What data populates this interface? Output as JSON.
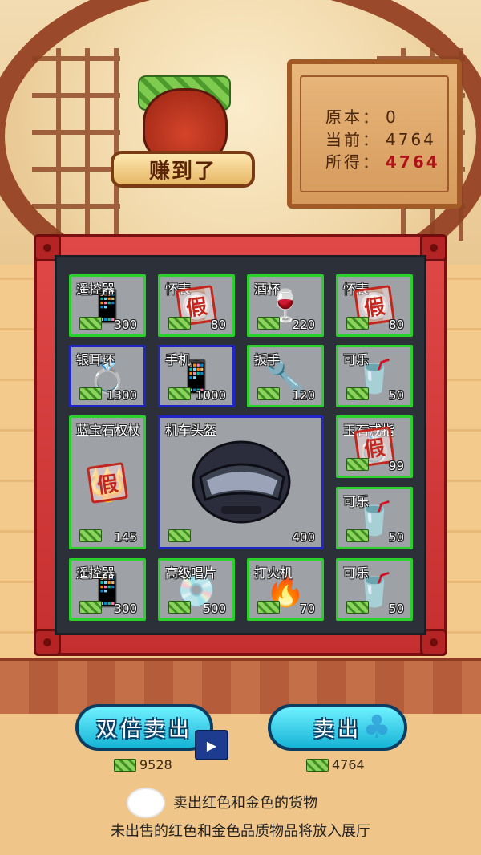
{
  "reward_badge": {
    "label": "赚到了"
  },
  "stats": {
    "original_label": "原本：",
    "original_value": "0",
    "current_label": "当前：",
    "current_value": "4764",
    "gain_label": "所得：",
    "gain_value": "4764"
  },
  "items": [
    {
      "name": "遥控器",
      "price": "300",
      "icon": "remote-icon",
      "art": "📱",
      "fake": false,
      "border": "green"
    },
    {
      "name": "怀表",
      "price": "80",
      "icon": "pocket-watch-icon",
      "art": "⌚",
      "fake": true,
      "border": "green"
    },
    {
      "name": "酒杯",
      "price": "220",
      "icon": "wine-glass-icon",
      "art": "🍷",
      "fake": false,
      "border": "green"
    },
    {
      "name": "怀表",
      "price": "80",
      "icon": "pocket-watch-icon",
      "art": "⌚",
      "fake": true,
      "border": "green"
    },
    {
      "name": "银耳环",
      "price": "1300",
      "icon": "earring-icon",
      "art": "💍",
      "fake": false,
      "border": "blue"
    },
    {
      "name": "手机",
      "price": "1000",
      "icon": "phone-icon",
      "art": "📱",
      "fake": false,
      "border": "blue"
    },
    {
      "name": "扳手",
      "price": "120",
      "icon": "wrench-icon",
      "art": "🔧",
      "fake": false,
      "border": "green"
    },
    {
      "name": "可乐",
      "price": "50",
      "icon": "cola-icon",
      "art": "🥤",
      "fake": false,
      "border": "green"
    },
    {
      "name": "蓝宝石权杖",
      "price": "145",
      "icon": "scepter-icon",
      "art": "🔱",
      "fake": true,
      "border": "green"
    },
    {
      "name": "机车头盔",
      "price": "400",
      "icon": "helmet-icon",
      "art": "",
      "fake": false,
      "border": "blue"
    },
    {
      "name": "玉石戒指",
      "price": "99",
      "icon": "jade-ring-icon",
      "art": "💍",
      "fake": true,
      "border": "green"
    },
    {
      "name": "可乐",
      "price": "50",
      "icon": "cola-icon",
      "art": "🥤",
      "fake": false,
      "border": "green"
    },
    {
      "name": "遥控器",
      "price": "300",
      "icon": "remote-icon",
      "art": "📱",
      "fake": false,
      "border": "green"
    },
    {
      "name": "高级唱片",
      "price": "500",
      "icon": "vinyl-record-icon",
      "art": "💿",
      "fake": false,
      "border": "green"
    },
    {
      "name": "打火机",
      "price": "70",
      "icon": "lighter-icon",
      "art": "🔥",
      "fake": false,
      "border": "green"
    },
    {
      "name": "可乐",
      "price": "50",
      "icon": "cola-icon",
      "art": "🥤",
      "fake": false,
      "border": "green"
    }
  ],
  "fake_stamp": "假",
  "buttons": {
    "double_sell": {
      "label": "双倍卖出",
      "amount": "9528"
    },
    "sell": {
      "label": "卖出",
      "amount": "4764"
    }
  },
  "option": {
    "label": "卖出红色和金色的货物",
    "checked": false
  },
  "note": "未出售的红色和金色品质物品将放入展厅",
  "colors": {
    "green_border": "#2bd12b",
    "blue_border": "#1f25c6",
    "case_red": "#d63b3b",
    "button_cyan": "#16b4d6"
  }
}
